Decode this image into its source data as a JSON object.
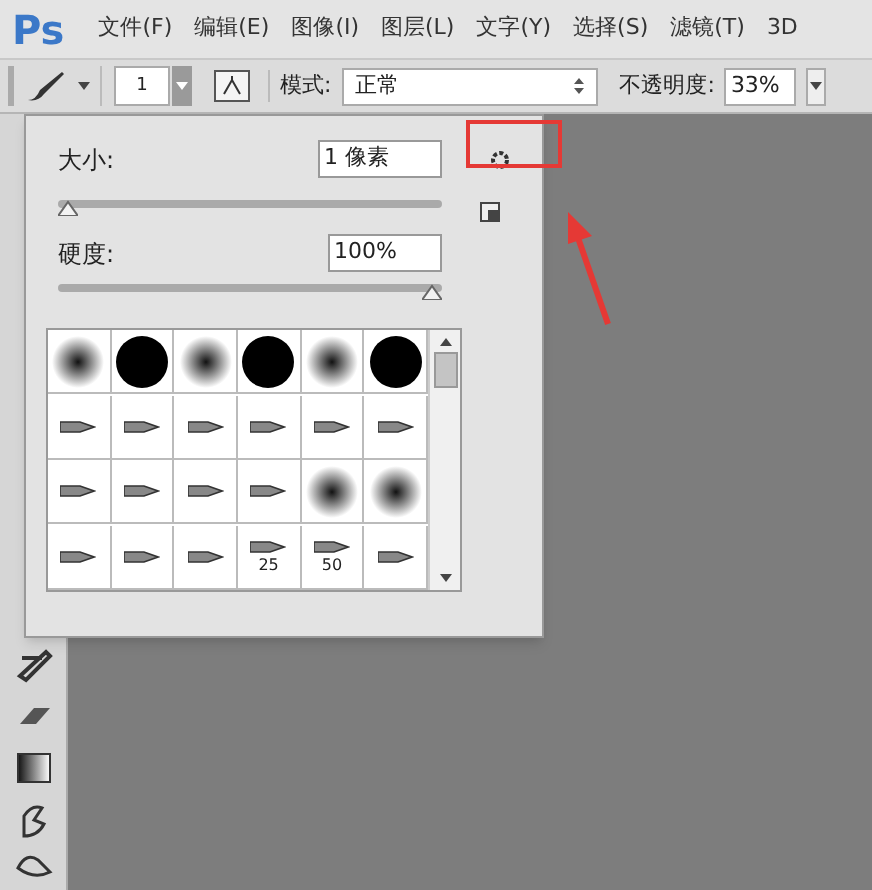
{
  "app": {
    "logo": "Ps"
  },
  "menu": [
    "文件(F)",
    "编辑(E)",
    "图像(I)",
    "图层(L)",
    "文字(Y)",
    "选择(S)",
    "滤镜(T)",
    "3D"
  ],
  "options_bar": {
    "brush_size": "1",
    "mode_label": "模式:",
    "mode": "正常",
    "opacity_label": "不透明度:",
    "opacity": "33%"
  },
  "brush_panel": {
    "size": {
      "label": "大小:",
      "value": "1 像素",
      "level": 0
    },
    "hardness": {
      "label": "硬度:",
      "value": "100%",
      "level": 1
    },
    "brushes": [
      {
        "kind": "soft"
      },
      {
        "kind": "hard"
      },
      {
        "kind": "soft"
      },
      {
        "kind": "hard"
      },
      {
        "kind": "soft"
      },
      {
        "kind": "hard"
      },
      {
        "kind": "tip"
      },
      {
        "kind": "tip"
      },
      {
        "kind": "tip"
      },
      {
        "kind": "tip"
      },
      {
        "kind": "tip"
      },
      {
        "kind": "tip"
      },
      {
        "kind": "tip"
      },
      {
        "kind": "tip"
      },
      {
        "kind": "tip"
      },
      {
        "kind": "tip"
      },
      {
        "kind": "soft"
      },
      {
        "kind": "soft"
      },
      {
        "kind": "tip"
      },
      {
        "kind": "tip"
      },
      {
        "kind": "tip"
      },
      {
        "kind": "tip",
        "label": "25"
      },
      {
        "kind": "tip",
        "label": "50"
      },
      {
        "kind": "tip"
      }
    ]
  }
}
